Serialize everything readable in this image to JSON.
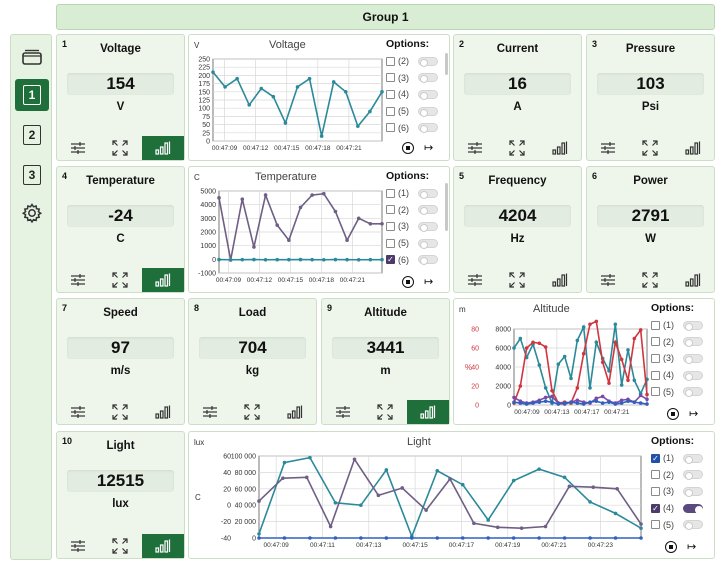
{
  "group_title": "Group 1",
  "sidebar": {
    "items": [
      {
        "name": "layers",
        "label": ""
      },
      {
        "name": "page-1",
        "label": "1"
      },
      {
        "name": "page-2",
        "label": "2"
      },
      {
        "name": "page-3",
        "label": "3"
      },
      {
        "name": "settings",
        "label": ""
      }
    ]
  },
  "cards": {
    "voltage": {
      "idx": "1",
      "title": "Voltage",
      "value": "154",
      "unit": "V"
    },
    "current": {
      "idx": "2",
      "title": "Current",
      "value": "16",
      "unit": "A"
    },
    "pressure": {
      "idx": "3",
      "title": "Pressure",
      "value": "103",
      "unit": "Psi"
    },
    "temperature": {
      "idx": "4",
      "title": "Temperature",
      "value": "-24",
      "unit": "C"
    },
    "frequency": {
      "idx": "5",
      "title": "Frequency",
      "value": "4204",
      "unit": "Hz"
    },
    "power": {
      "idx": "6",
      "title": "Power",
      "value": "2791",
      "unit": "W"
    },
    "speed": {
      "idx": "7",
      "title": "Speed",
      "value": "97",
      "unit": "m/s"
    },
    "load": {
      "idx": "8",
      "title": "Load",
      "value": "704",
      "unit": "kg"
    },
    "altitude": {
      "idx": "9",
      "title": "Altitude",
      "value": "3441",
      "unit": "m"
    },
    "light": {
      "idx": "10",
      "title": "Light",
      "value": "12515",
      "unit": "lux"
    }
  },
  "options_label": "Options:",
  "chart_data": [
    {
      "type": "line",
      "title": "Voltage",
      "corner_label": "V",
      "x": [
        "00:47:09",
        "00:47:12",
        "00:47:15",
        "00:47:18",
        "00:47:21"
      ],
      "ylim": [
        0,
        250
      ],
      "yticks": [
        0,
        25,
        50,
        75,
        100,
        125,
        150,
        175,
        200,
        225,
        250
      ],
      "options": [
        "(2)",
        "(3)",
        "(4)",
        "(5)",
        "(6)"
      ],
      "options_checked": [
        false,
        false,
        false,
        false,
        false
      ],
      "series": [
        {
          "color": "#2b8a9a",
          "values": [
            210,
            165,
            190,
            110,
            160,
            135,
            55,
            165,
            190,
            15,
            180,
            150,
            45,
            90,
            150
          ]
        }
      ]
    },
    {
      "type": "line",
      "title": "Temperature",
      "corner_label": "C",
      "x": [
        "00:47:09",
        "00:47:12",
        "00:47:15",
        "00:47:18",
        "00:47:21"
      ],
      "ylim": [
        -1000,
        5000
      ],
      "yticks": [
        -1000,
        0,
        1000,
        2000,
        3000,
        4000,
        5000
      ],
      "options": [
        "(1)",
        "(2)",
        "(3)",
        "(5)",
        "(6)"
      ],
      "options_checked": [
        false,
        false,
        false,
        false,
        true
      ],
      "series": [
        {
          "color": "#6f5f85",
          "values": [
            4500,
            -50,
            4400,
            900,
            4700,
            2500,
            1400,
            3800,
            4700,
            4800,
            3500,
            1400,
            3000,
            2600,
            2600
          ]
        },
        {
          "color": "#2b8a9a",
          "values": [
            -20,
            -30,
            -25,
            -20,
            -30,
            -25,
            -25,
            -20,
            -25,
            -30,
            -20,
            -25,
            -30,
            -25,
            -25
          ]
        }
      ]
    },
    {
      "type": "line",
      "title": "Altitude",
      "corner_label": "m",
      "y2_label": "%",
      "x": [
        "00:47:09",
        "00:47:13",
        "00:47:17",
        "00:47:21"
      ],
      "ylim": [
        0,
        8000
      ],
      "yticks": [
        0,
        2000,
        4000,
        6000,
        8000
      ],
      "y2ticks": [
        0,
        20,
        40,
        60,
        80
      ],
      "options": [
        "(1)",
        "(2)",
        "(3)",
        "(4)",
        "(5)"
      ],
      "options_checked": [
        false,
        false,
        false,
        false,
        false
      ],
      "series": [
        {
          "color": "#2b8a9a",
          "values": [
            6000,
            7000,
            5000,
            6400,
            4200,
            1800,
            200,
            4300,
            5100,
            2800,
            6800,
            8200,
            1800,
            6600,
            4900,
            3600,
            8500,
            2100,
            5800,
            2600,
            1200,
            2700
          ]
        },
        {
          "color": "#d0363f",
          "values": [
            200,
            2000,
            6000,
            6600,
            6500,
            6100,
            1500,
            200,
            300,
            200,
            1800,
            5400,
            8500,
            8800,
            4500,
            2300,
            6600,
            4800,
            2600,
            7000,
            7900,
            1100
          ]
        },
        {
          "color": "#7b4aa8",
          "values": [
            800,
            400,
            200,
            300,
            500,
            800,
            900,
            200,
            100,
            300,
            500,
            300,
            200,
            700,
            900,
            400,
            200,
            500,
            600,
            300,
            1000,
            600
          ]
        },
        {
          "color": "#3060c0",
          "values": [
            300,
            200,
            100,
            200,
            300,
            400,
            300,
            100,
            200,
            300,
            200,
            100,
            300,
            400,
            200,
            300,
            100,
            200,
            400,
            300,
            200,
            100
          ]
        }
      ]
    },
    {
      "type": "line",
      "title": "Light",
      "corner_label": "lux",
      "ylabel_left": "C",
      "x": [
        "00:47:09",
        "00:47:11",
        "00:47:13",
        "00:47:15",
        "00:47:17",
        "00:47:19",
        "00:47:21",
        "00:47:23"
      ],
      "ylim": [
        0,
        100000
      ],
      "yticks": [
        "0",
        "20 000",
        "40 000",
        "60 000",
        "80 000",
        "100 000"
      ],
      "y_left_ticks": [
        -40,
        -20,
        0,
        20,
        40,
        60
      ],
      "options": [
        "(1)",
        "(2)",
        "(3)",
        "(4)",
        "(5)"
      ],
      "options_checked": [
        true,
        false,
        false,
        true,
        false
      ],
      "series": [
        {
          "color": "#2b8a9a",
          "values": [
            5000,
            92000,
            98000,
            43000,
            40000,
            83000,
            2000,
            82000,
            65000,
            22000,
            70000,
            84000,
            74000,
            44000,
            30000,
            12000
          ]
        },
        {
          "color": "#6f5f85",
          "values": [
            45000,
            73000,
            74000,
            14000,
            96000,
            52000,
            61000,
            34000,
            72000,
            18000,
            13000,
            12000,
            14000,
            63000,
            62000,
            60000,
            17000
          ]
        },
        {
          "color": "#3060c0",
          "values": [
            0,
            0,
            0,
            0,
            0,
            0,
            0,
            0,
            0,
            0,
            0,
            0,
            0,
            0,
            0,
            0
          ]
        }
      ]
    }
  ]
}
